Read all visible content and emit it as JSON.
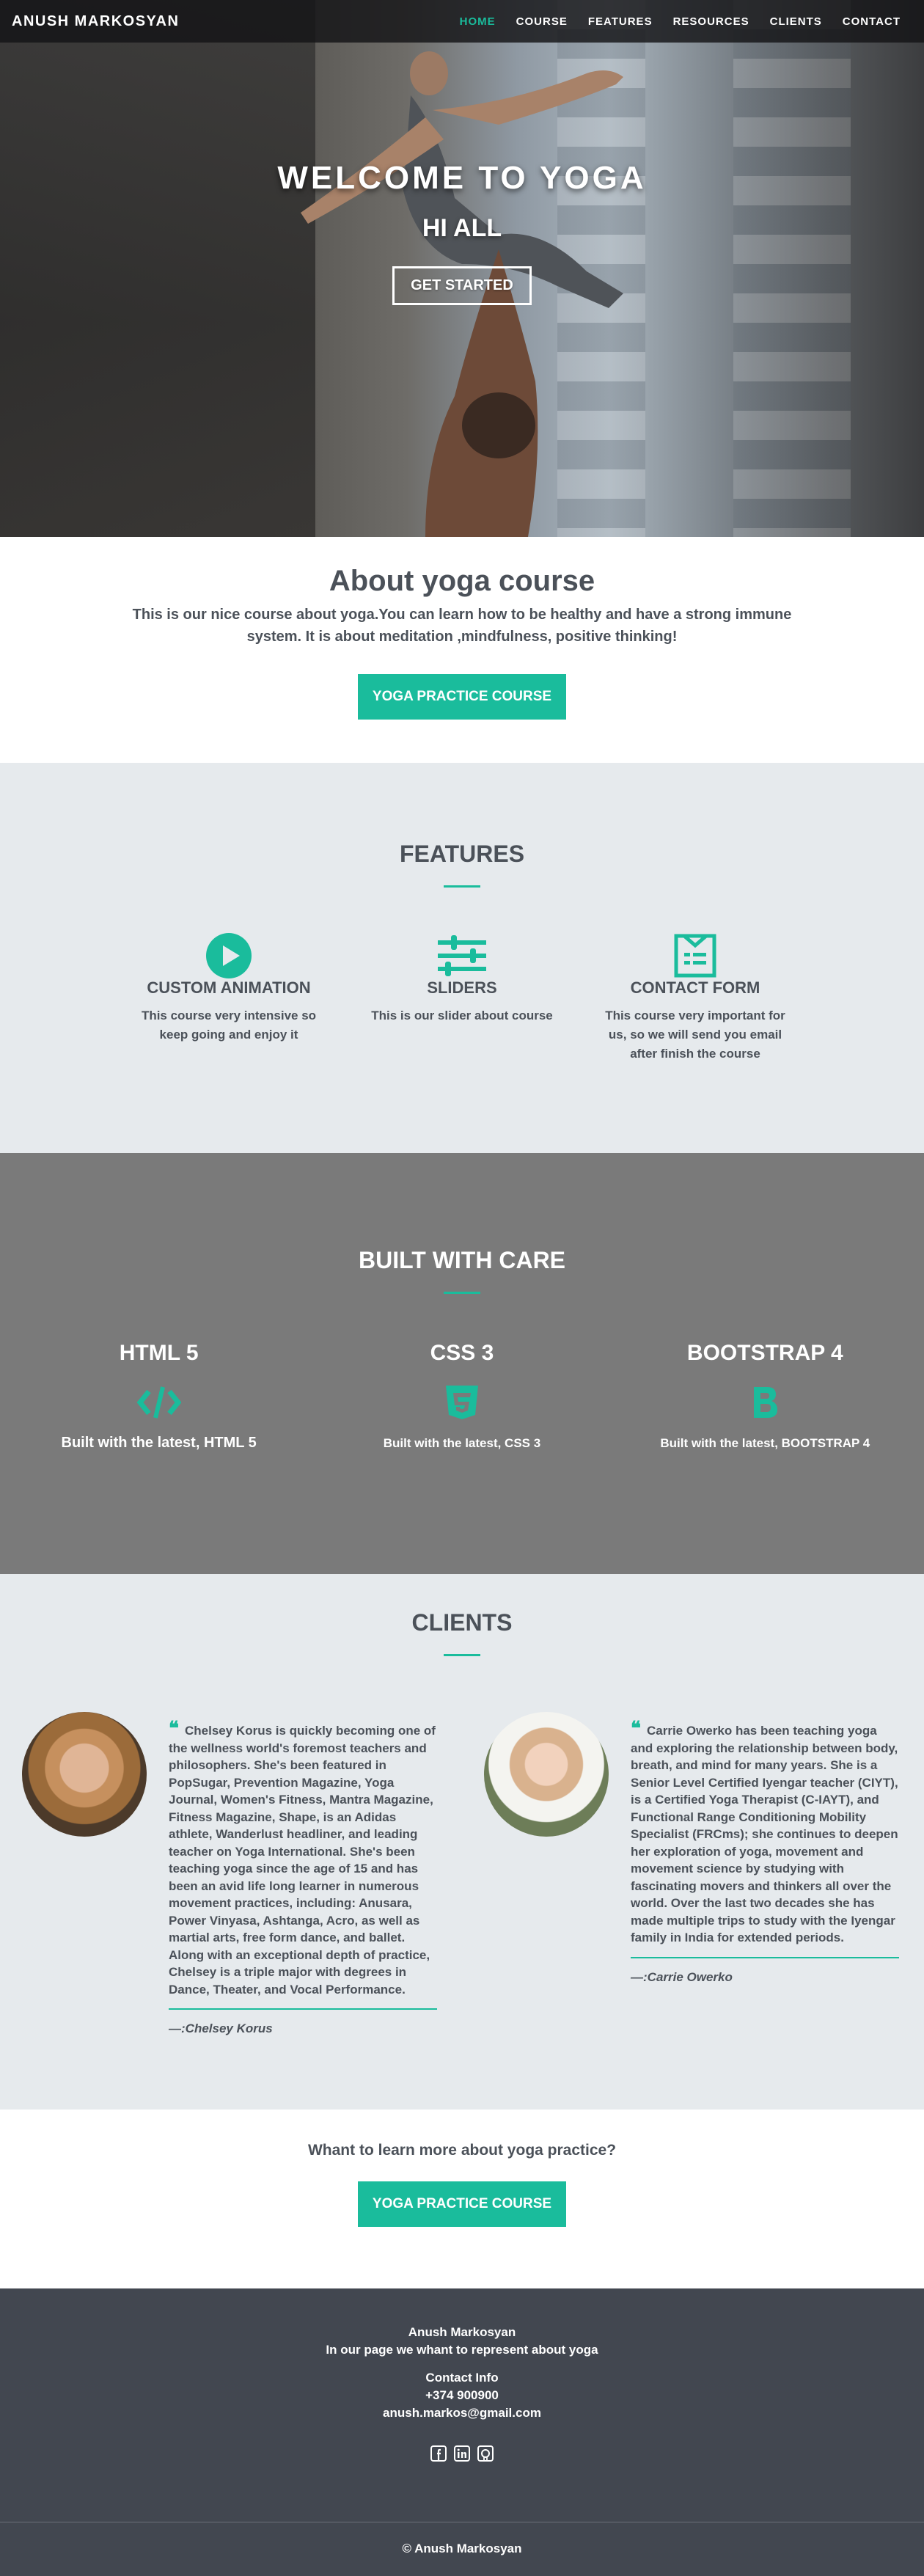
{
  "nav": {
    "brand": "ANUSH MARKOSYAN",
    "items": [
      {
        "label": "HOME",
        "active": true
      },
      {
        "label": "COURSE"
      },
      {
        "label": "FEATURES"
      },
      {
        "label": "RESOURCES"
      },
      {
        "label": "CLIENTS"
      },
      {
        "label": "CONTACT"
      }
    ]
  },
  "hero": {
    "title": "WELCOME TO YOGA",
    "subtitle": "HI ALL",
    "button": "GET STARTED"
  },
  "about": {
    "title": "About yoga course",
    "text": "This is our nice course about yoga.You can learn how to be healthy and have a strong immune system. It is about meditation ,mindfulness, positive thinking!",
    "button": "YOGA PRACTICE COURSE"
  },
  "features": {
    "title": "FEATURES",
    "items": [
      {
        "icon": "play-icon",
        "title": "CUSTOM ANIMATION",
        "text": "This course very intensive so keep going and enjoy it"
      },
      {
        "icon": "sliders-icon",
        "title": "SLIDERS",
        "text": "This is our slider about course"
      },
      {
        "icon": "form-icon",
        "title": "CONTACT FORM",
        "text": "This course very important for us, so we will send you email after finish the course"
      }
    ]
  },
  "built": {
    "title": "BUILT WITH CARE",
    "items": [
      {
        "title": "HTML 5",
        "icon": "code-icon",
        "text": "Built with the latest, HTML 5"
      },
      {
        "title": "CSS 3",
        "icon": "css3-icon",
        "text": "Built with the latest, CSS 3"
      },
      {
        "title": "BOOTSTRAP 4",
        "icon": "bootstrap-icon",
        "text": "Built with the latest, BOOTSTRAP 4"
      }
    ]
  },
  "clients": {
    "title": "CLIENTS",
    "items": [
      {
        "quote": "Chelsey Korus is quickly becoming one of the wellness world's foremost teachers and philosophers. She's been featured in PopSugar, Prevention Magazine, Yoga Journal, Women's Fitness, Mantra Magazine, Fitness Magazine, Shape, is an Adidas athlete, Wanderlust headliner, and leading teacher on Yoga International. She's been teaching yoga since the age of 15 and has been an avid life long learner in numerous movement practices, including: Anusara, Power Vinyasa, Ashtanga, Acro, as well as martial arts, free form dance, and ballet. Along with an exceptional depth of practice, Chelsey is a triple major with degrees in Dance, Theater, and Vocal Performance.",
        "author": "—:Chelsey Korus"
      },
      {
        "quote": "Carrie Owerko has been teaching yoga and exploring the relationship between body, breath, and mind for many years. She is a Senior Level Certified Iyengar teacher (CIYT), is a Certified Yoga Therapist (C-IAYT), and Functional Range Conditioning Mobility Specialist (FRCms); she continues to deepen her exploration of yoga, movement and movement science by studying with fascinating movers and thinkers all over the world. Over the last two decades she has made multiple trips to study with the Iyengar family in India for extended periods.",
        "author": "—:Carrie Owerko"
      }
    ]
  },
  "cta": {
    "text": "Whant to learn more about yoga practice?",
    "button": "YOGA PRACTICE COURSE"
  },
  "footer": {
    "name": "Anush Markosyan",
    "tagline": "In our page we whant to represent about yoga",
    "contact_title": "Contact Info",
    "phone": "+374 900900",
    "email": "anush.markos@gmail.com",
    "socials": [
      "facebook-icon",
      "linkedin-icon",
      "github-icon"
    ],
    "copyright": "© Anush Markosyan"
  },
  "colors": {
    "accent": "#1abc9c",
    "text": "#4b5159",
    "light_bg": "#e6eaed",
    "gray_bg": "#7a7a7a",
    "footer_bg": "#424750"
  }
}
